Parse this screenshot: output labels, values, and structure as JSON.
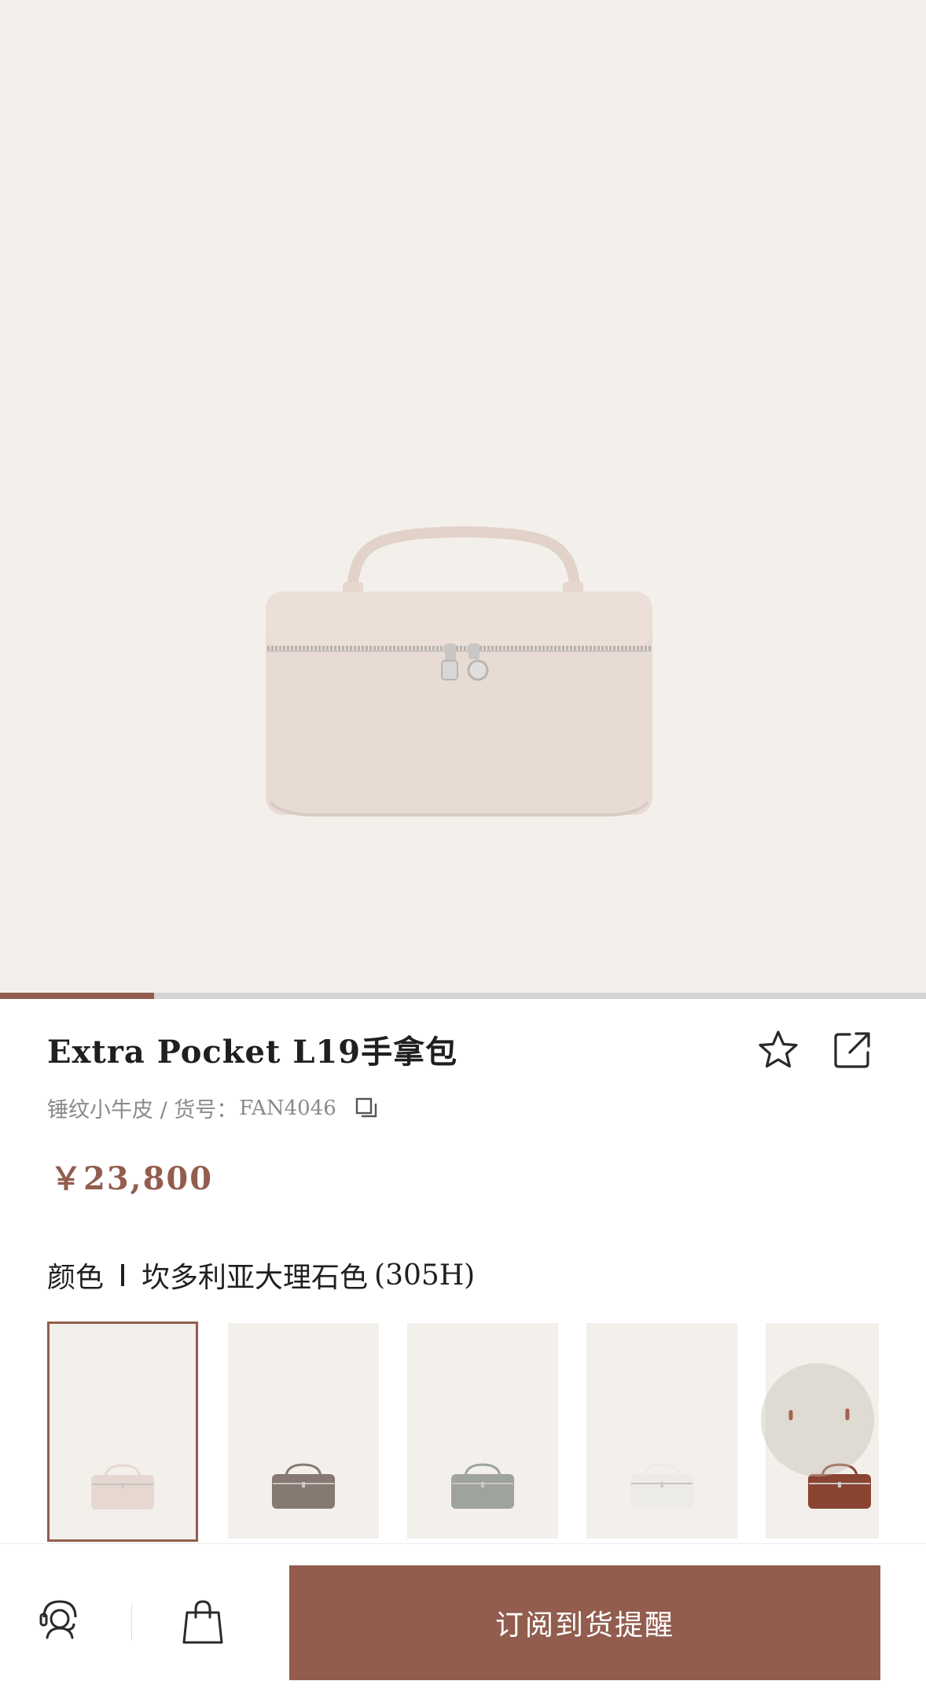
{
  "gallery": {
    "current_slide_fraction": 0.166
  },
  "product": {
    "title": "Extra Pocket L19手拿包",
    "material": "锤纹小牛皮 / 货号：",
    "sku": "FAN4046",
    "price": "￥23,800"
  },
  "color": {
    "label": "颜色",
    "selected_name": "坎多利亚大理石色",
    "selected_code": "(305H)",
    "swatches": [
      {
        "bag_color": "#e6d8d1",
        "selected": true
      },
      {
        "bag_color": "#857971",
        "selected": false
      },
      {
        "bag_color": "#9ea39b",
        "selected": false
      },
      {
        "bag_color": "#ecebe6",
        "selected": false
      },
      {
        "bag_color": "#8a4532",
        "selected": false
      }
    ]
  },
  "icons": {
    "favorite": "star-icon",
    "share": "share-icon",
    "copy": "copy-icon",
    "service": "customer-service-icon",
    "bag": "shopping-bag-icon"
  },
  "bottom_bar": {
    "cta_label": "订阅到货提醒"
  },
  "colors": {
    "accent": "#925d4e",
    "background": "#f3f0eb",
    "text": "#1f1f1f",
    "muted": "#8a8a8a"
  }
}
